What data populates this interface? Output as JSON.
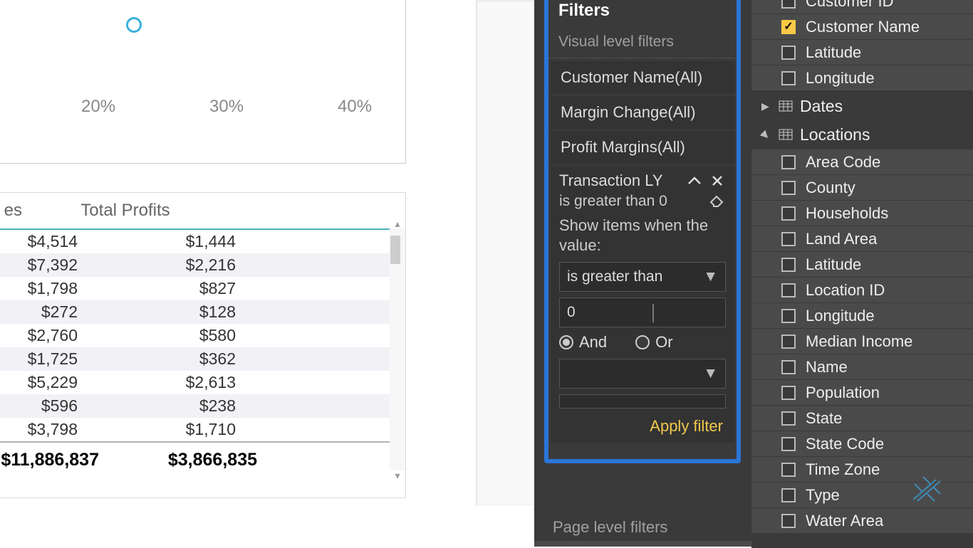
{
  "chart": {
    "axis_labels": [
      "%",
      "20%",
      "30%",
      "40%"
    ]
  },
  "table": {
    "headers": {
      "col_a": "es",
      "col_b": "Total Profits"
    },
    "rows": [
      {
        "a": "$4,514",
        "b": "$1,444"
      },
      {
        "a": "$7,392",
        "b": "$2,216"
      },
      {
        "a": "$1,798",
        "b": "$827"
      },
      {
        "a": "$272",
        "b": "$128"
      },
      {
        "a": "$2,760",
        "b": "$580"
      },
      {
        "a": "$1,725",
        "b": "$362"
      },
      {
        "a": "$5,229",
        "b": "$2,613"
      },
      {
        "a": "$596",
        "b": "$238"
      },
      {
        "a": "$3,798",
        "b": "$1,710"
      }
    ],
    "total": {
      "a": "$11,886,837",
      "b": "$3,866,835"
    }
  },
  "filters": {
    "title": "Filters",
    "visual_level_label": "Visual level filters",
    "items": [
      "Customer Name(All)",
      "Margin Change(All)",
      "Profit Margins(All)"
    ],
    "open": {
      "name": "Transaction LY",
      "summary": "is greater than 0",
      "prompt": "Show items when the value:",
      "op1": "is greater than",
      "val1": "0",
      "logic_and": "And",
      "logic_or": "Or",
      "op2": "",
      "val2": "",
      "apply": "Apply filter"
    },
    "page_level_label": "Page level filters"
  },
  "fields": {
    "group_a": [
      {
        "label": "Customer ID",
        "checked": false
      },
      {
        "label": "Customer Name",
        "checked": true
      },
      {
        "label": "Latitude",
        "checked": false
      },
      {
        "label": "Longitude",
        "checked": false
      }
    ],
    "tables": [
      {
        "name": "Dates",
        "expanded": false
      },
      {
        "name": "Locations",
        "expanded": true
      }
    ],
    "locations_fields": [
      "Area Code",
      "County",
      "Households",
      "Land Area",
      "Latitude",
      "Location ID",
      "Longitude",
      "Median Income",
      "Name",
      "Population",
      "State",
      "State Code",
      "Time Zone",
      "Type",
      "Water Area"
    ]
  }
}
